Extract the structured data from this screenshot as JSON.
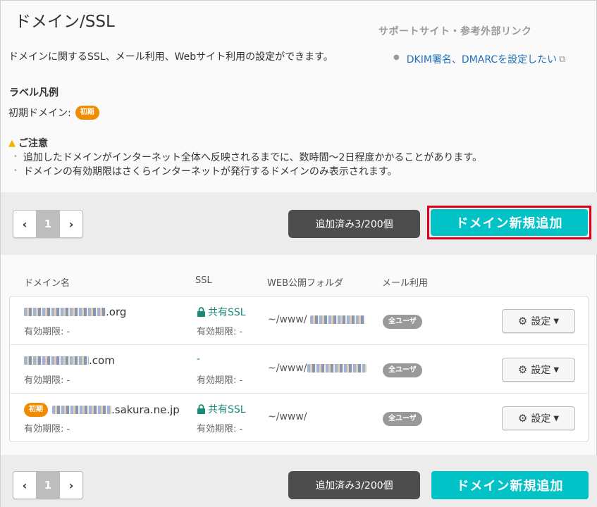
{
  "page": {
    "title": "ドメイン/SSL",
    "support_label": "サポートサイト・参考外部リンク",
    "intro": "ドメインに関するSSL、メール利用、Webサイト利用の設定ができます。",
    "support_link": "DKIM署名、DMARCを設定したい"
  },
  "legend": {
    "title": "ラベル凡例",
    "initial_domain_label": "初期ドメイン:",
    "initial_badge": "初期"
  },
  "notice": {
    "title": "ご注意",
    "items": [
      "追加したドメインがインターネット全体へ反映されるまでに、数時間〜2日程度かかることがあります。",
      "ドメインの有効期限はさくらインターネットが発行するドメインのみ表示されます。"
    ]
  },
  "toolbar": {
    "prev": "‹",
    "page": "1",
    "next": "›",
    "count": "追加済み3/200個",
    "add_button": "ドメイン新規追加"
  },
  "table": {
    "headers": [
      "ドメイン名",
      "SSL",
      "WEB公開フォルダ",
      "メール利用"
    ],
    "rows": [
      {
        "domain_suffix": ".org",
        "expiry": "有効期限: -",
        "ssl": "共有SSL",
        "ssl_expiry": "有効期限: -",
        "folder": "~/www/",
        "mail": "全ユーザ",
        "settings": "設定",
        "initial": ""
      },
      {
        "domain_suffix": ".com",
        "expiry": "有効期限: -",
        "ssl": "-",
        "ssl_expiry": "有効期限: -",
        "folder": "~/www/",
        "mail": "全ユーザ",
        "settings": "設定",
        "initial": ""
      },
      {
        "domain_suffix": ".sakura.ne.jp",
        "expiry": "有効期限: -",
        "ssl": "共有SSL",
        "ssl_expiry": "有効期限: -",
        "folder": "~/www/",
        "mail": "全ユーザ",
        "settings": "設定",
        "initial": "初期"
      }
    ]
  },
  "colors": {
    "accent": "#00c2c7",
    "badge_initial": "#f08c00",
    "ssl_green": "#1a8a78",
    "highlight": "#e0001b"
  },
  "icons": [
    "warning-icon",
    "external-link-icon",
    "lock-icon",
    "gear-icon",
    "chevron-down-icon",
    "chevron-left-icon",
    "chevron-right-icon"
  ]
}
